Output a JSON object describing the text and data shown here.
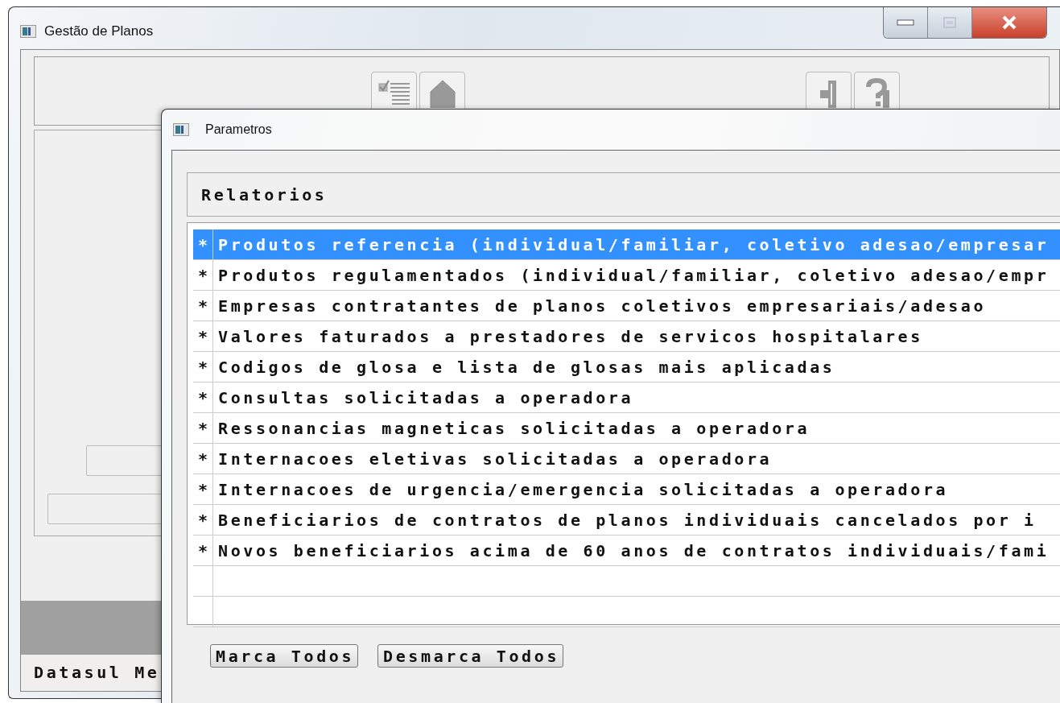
{
  "main_window": {
    "title": "Gestão de Planos",
    "status_text": "Datasul Me"
  },
  "dialog": {
    "title": "Parametros",
    "list": {
      "header": "Relatorios",
      "rows": [
        {
          "kind": "item",
          "mark": "*",
          "text": "Produtos referencia (individual/familiar, coletivo adesao/empresar",
          "selected": true
        },
        {
          "kind": "item",
          "mark": "*",
          "text": "Produtos regulamentados (individual/familiar, coletivo adesao/empr",
          "selected": false
        },
        {
          "kind": "item",
          "mark": "*",
          "text": "Empresas contratantes de planos coletivos empresariais/adesao",
          "selected": false
        },
        {
          "kind": "item",
          "mark": "*",
          "text": "Valores faturados a prestadores de servicos hospitalares",
          "selected": false
        },
        {
          "kind": "item",
          "mark": "*",
          "text": "Codigos de glosa e lista de glosas mais aplicadas",
          "selected": false
        },
        {
          "kind": "item",
          "mark": "*",
          "text": "Consultas solicitadas a operadora",
          "selected": false
        },
        {
          "kind": "item",
          "mark": "*",
          "text": "Ressonancias magneticas solicitadas a operadora",
          "selected": false
        },
        {
          "kind": "item",
          "mark": "*",
          "text": "Internacoes eletivas solicitadas a operadora",
          "selected": false
        },
        {
          "kind": "item",
          "mark": "*",
          "text": "Internacoes de urgencia/emergencia solicitadas a operadora",
          "selected": false
        },
        {
          "kind": "item",
          "mark": "*",
          "text": "Beneficiarios de contratos de planos individuais cancelados por i",
          "selected": false
        },
        {
          "kind": "item",
          "mark": "*",
          "text": "Novos beneficiarios acima de 60 anos de contratos individuais/fami",
          "selected": false
        },
        {
          "kind": "empty",
          "selected": false
        },
        {
          "kind": "empty",
          "selected": false
        }
      ]
    },
    "buttons": [
      "Marca Todos",
      "Desmarca Todos"
    ]
  }
}
